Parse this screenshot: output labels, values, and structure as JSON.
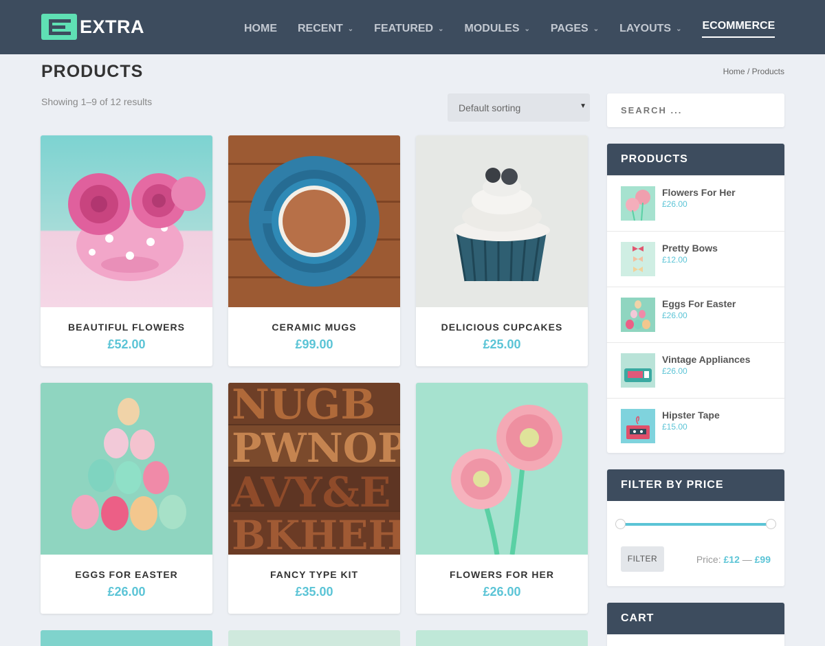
{
  "header": {
    "logo_text": "EXTRA",
    "nav": [
      {
        "label": "HOME",
        "dropdown": false
      },
      {
        "label": "RECENT",
        "dropdown": true
      },
      {
        "label": "FEATURED",
        "dropdown": true
      },
      {
        "label": "MODULES",
        "dropdown": true
      },
      {
        "label": "PAGES",
        "dropdown": true
      },
      {
        "label": "LAYOUTS",
        "dropdown": true
      },
      {
        "label": "ECOMMERCE",
        "dropdown": false,
        "active": true
      }
    ]
  },
  "page": {
    "title": "PRODUCTS",
    "breadcrumb": {
      "home": "Home",
      "sep": "/",
      "current": "Products"
    },
    "result_count": "Showing 1–9 of 12 results",
    "sort_value": "Default sorting"
  },
  "products": [
    {
      "name": "BEAUTIFUL FLOWERS",
      "price": "£52.00",
      "image": "pink-roses-in-polka-dot-cup"
    },
    {
      "name": "CERAMIC MUGS",
      "price": "£99.00",
      "image": "blue-coffee-cup-on-wood"
    },
    {
      "name": "DELICIOUS CUPCAKES",
      "price": "£25.00",
      "image": "cupcake"
    },
    {
      "name": "EGGS FOR EASTER",
      "price": "£26.00",
      "image": "easter-egg-pyramid"
    },
    {
      "name": "FANCY TYPE KIT",
      "price": "£35.00",
      "image": "wooden-letterpress-type"
    },
    {
      "name": "FLOWERS FOR HER",
      "price": "£26.00",
      "image": "pink-gerbera-daisies"
    }
  ],
  "sidebar": {
    "search_placeholder": "SEARCH ...",
    "products_widget": {
      "title": "PRODUCTS",
      "items": [
        {
          "name": "Flowers For Her",
          "price": "£26.00"
        },
        {
          "name": "Pretty Bows",
          "price": "£12.00"
        },
        {
          "name": "Eggs For Easter",
          "price": "£26.00"
        },
        {
          "name": "Vintage Appliances",
          "price": "£26.00"
        },
        {
          "name": "Hipster Tape",
          "price": "£15.00"
        }
      ]
    },
    "filter": {
      "title": "FILTER BY PRICE",
      "button": "FILTER",
      "price_label": "Price:",
      "min": "£12",
      "dash": "—",
      "max": "£99",
      "range_fraction": [
        0,
        1
      ]
    },
    "cart_title": "CART"
  },
  "colors": {
    "header": "#3d4c5e",
    "accent": "#5bc4d6",
    "logo": "#5fe0b4",
    "background": "#eceff4"
  }
}
